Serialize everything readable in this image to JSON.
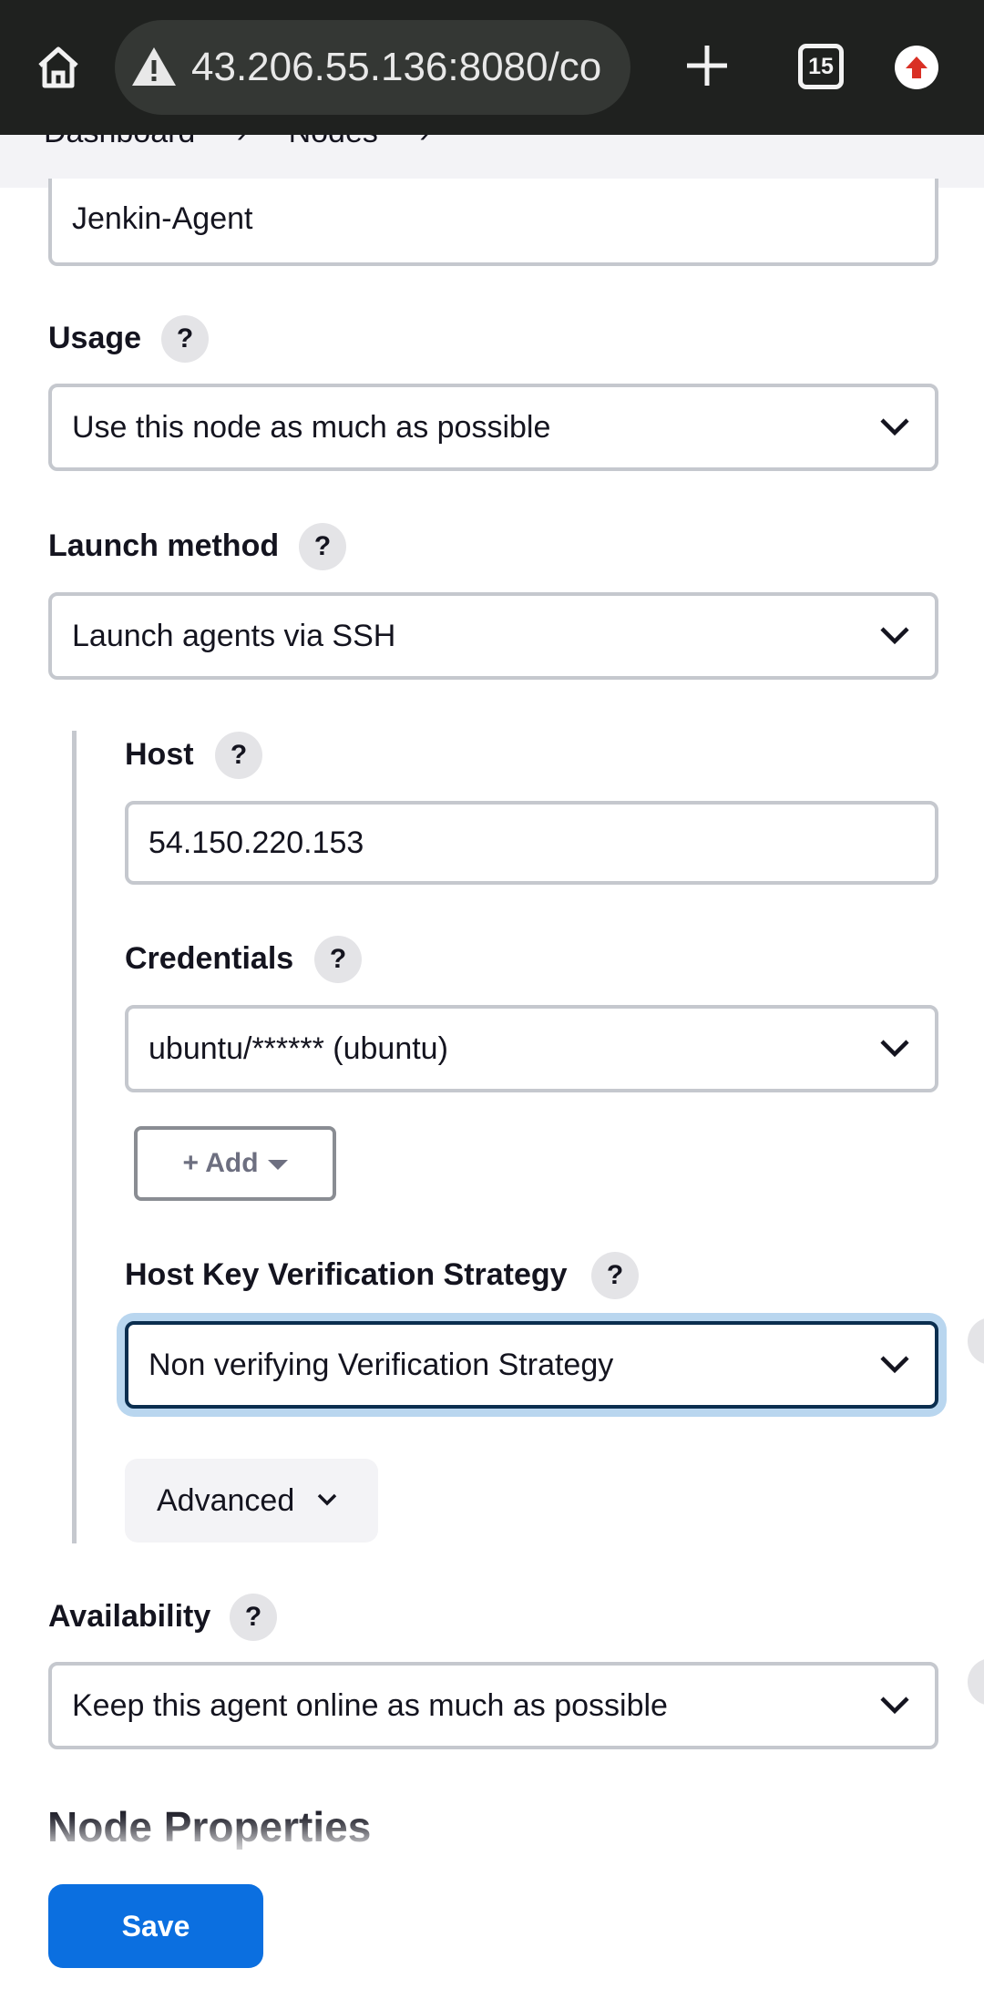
{
  "browser": {
    "url": "43.206.55.136:8080/co",
    "tab_count": "15",
    "icons": [
      "home-icon",
      "not-secure-warning-icon",
      "new-tab-icon",
      "tab-switcher-icon",
      "update-arrow-icon"
    ]
  },
  "breadcrumb": {
    "items": [
      "Dashboard",
      "Nodes"
    ]
  },
  "form": {
    "name_value": "Jenkin-Agent",
    "usage": {
      "label": "Usage",
      "help": "?",
      "selected": "Use this node as much as possible"
    },
    "launch_method": {
      "label": "Launch method",
      "help": "?",
      "selected": "Launch agents via SSH"
    },
    "host": {
      "label": "Host",
      "help": "?",
      "value": "54.150.220.153"
    },
    "credentials": {
      "label": "Credentials",
      "help": "?",
      "selected": "ubuntu/****** (ubuntu)",
      "add_label": "+ Add"
    },
    "host_key": {
      "label": "Host Key Verification Strategy",
      "help": "?",
      "selected": "Non verifying Verification Strategy"
    },
    "advanced_label": "Advanced",
    "availability": {
      "label": "Availability",
      "help": "?",
      "selected": "Keep this agent online as much as possible"
    },
    "node_properties_title": "Node Properties"
  },
  "actions": {
    "save_label": "Save"
  },
  "colors": {
    "chrome_bg": "#1f211f",
    "primary_button": "#0b6fe0",
    "focus_ring": "#b9d6ef",
    "field_border": "#c5c8ce"
  }
}
